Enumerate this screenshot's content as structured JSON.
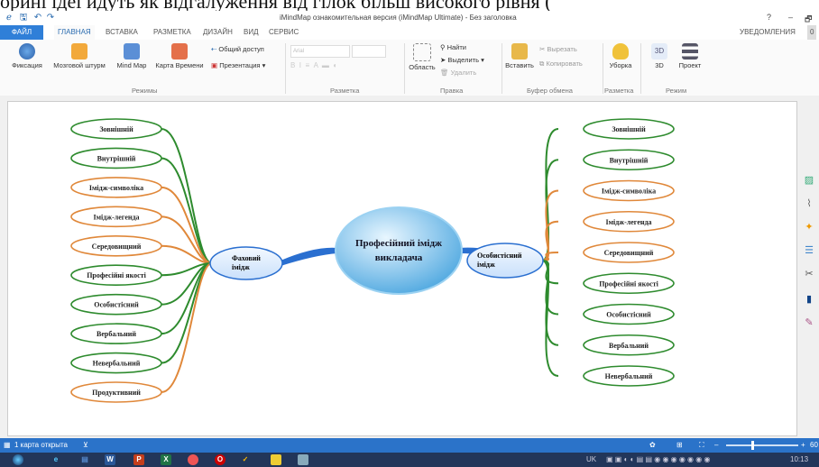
{
  "caption": "орині ідеї йдуть як відгалуження від гілок більш високого рівня (",
  "window": {
    "title": "iMindMap ознакомительная версия (iMindMap Ultimate) - Без заголовка",
    "controls": [
      "?",
      "–",
      "🗗"
    ]
  },
  "tabs": {
    "file": "ФАЙЛ",
    "items": [
      "ГЛАВНАЯ",
      "ВСТАВКА",
      "РАЗМЕТКА",
      "ДИЗАЙН",
      "ВИД",
      "СЕРВИС"
    ],
    "notifications": "УВЕДОМЛЕНИЯ",
    "notif_count": "0"
  },
  "ribbon": {
    "buttons": {
      "fix": "Фиксация",
      "brainstorm": "Мозговой штурм",
      "mindmap": "Mind Map",
      "timemap": "Карта Времени",
      "share": "Общий доступ",
      "presentation": "Презентация ▾",
      "font_placeholder": "Arial",
      "find": "Найти",
      "select": "Выделить ▾",
      "delete": "Удалить",
      "area": "Область",
      "paste": "Вставить",
      "cut": "Вырезать",
      "copy": "Копировать",
      "cleanup": "Уборка",
      "view3d": "3D",
      "project": "Проект"
    },
    "groups": {
      "modes": "Режимы",
      "layout": "Разметка",
      "edit": "Правка",
      "clipboard": "Буфер обмена",
      "layout2": "Разметка",
      "mode": "Режим"
    }
  },
  "mindmap": {
    "central": [
      "Професійний імідж",
      "викладача"
    ],
    "left_main": [
      "Фаховий",
      "імідж"
    ],
    "right_main": [
      "Особистісний",
      "імідж"
    ],
    "left_branches": [
      {
        "label": "Зовнішній",
        "color": "#2e8b2e"
      },
      {
        "label": "Внутрішній",
        "color": "#2e8b2e"
      },
      {
        "label": "Імідж-символіка",
        "color": "#e0883a"
      },
      {
        "label": "Імідж-легенда",
        "color": "#e0883a"
      },
      {
        "label": "Середовищний",
        "color": "#e0883a"
      },
      {
        "label": "Професійні якості",
        "color": "#2e8b2e"
      },
      {
        "label": "Особистісний",
        "color": "#2e8b2e"
      },
      {
        "label": "Вербальний",
        "color": "#2e8b2e"
      },
      {
        "label": "Невербальний",
        "color": "#2e8b2e"
      },
      {
        "label": "Продуктивний",
        "color": "#e0883a"
      }
    ],
    "right_branches": [
      {
        "label": "Зовнішній",
        "color": "#2e8b2e"
      },
      {
        "label": "Внутрішній",
        "color": "#2e8b2e"
      },
      {
        "label": "Імідж-символіка",
        "color": "#e0883a"
      },
      {
        "label": "Імідж-легенда",
        "color": "#e0883a"
      },
      {
        "label": "Середовищний",
        "color": "#e0883a"
      },
      {
        "label": "Професійні якості",
        "color": "#2e8b2e"
      },
      {
        "label": "Особистісний",
        "color": "#2e8b2e"
      },
      {
        "label": "Вербальний",
        "color": "#2e8b2e"
      },
      {
        "label": "Невербальний",
        "color": "#2e8b2e"
      }
    ],
    "colors": {
      "central": "#7ec8f0",
      "main": "#dcecff",
      "connector": "#2a6fd0"
    }
  },
  "status": {
    "maps_open": "1 карта открыта",
    "zoom": "60"
  },
  "taskbar": {
    "lang": "UK",
    "time": "10:13"
  }
}
